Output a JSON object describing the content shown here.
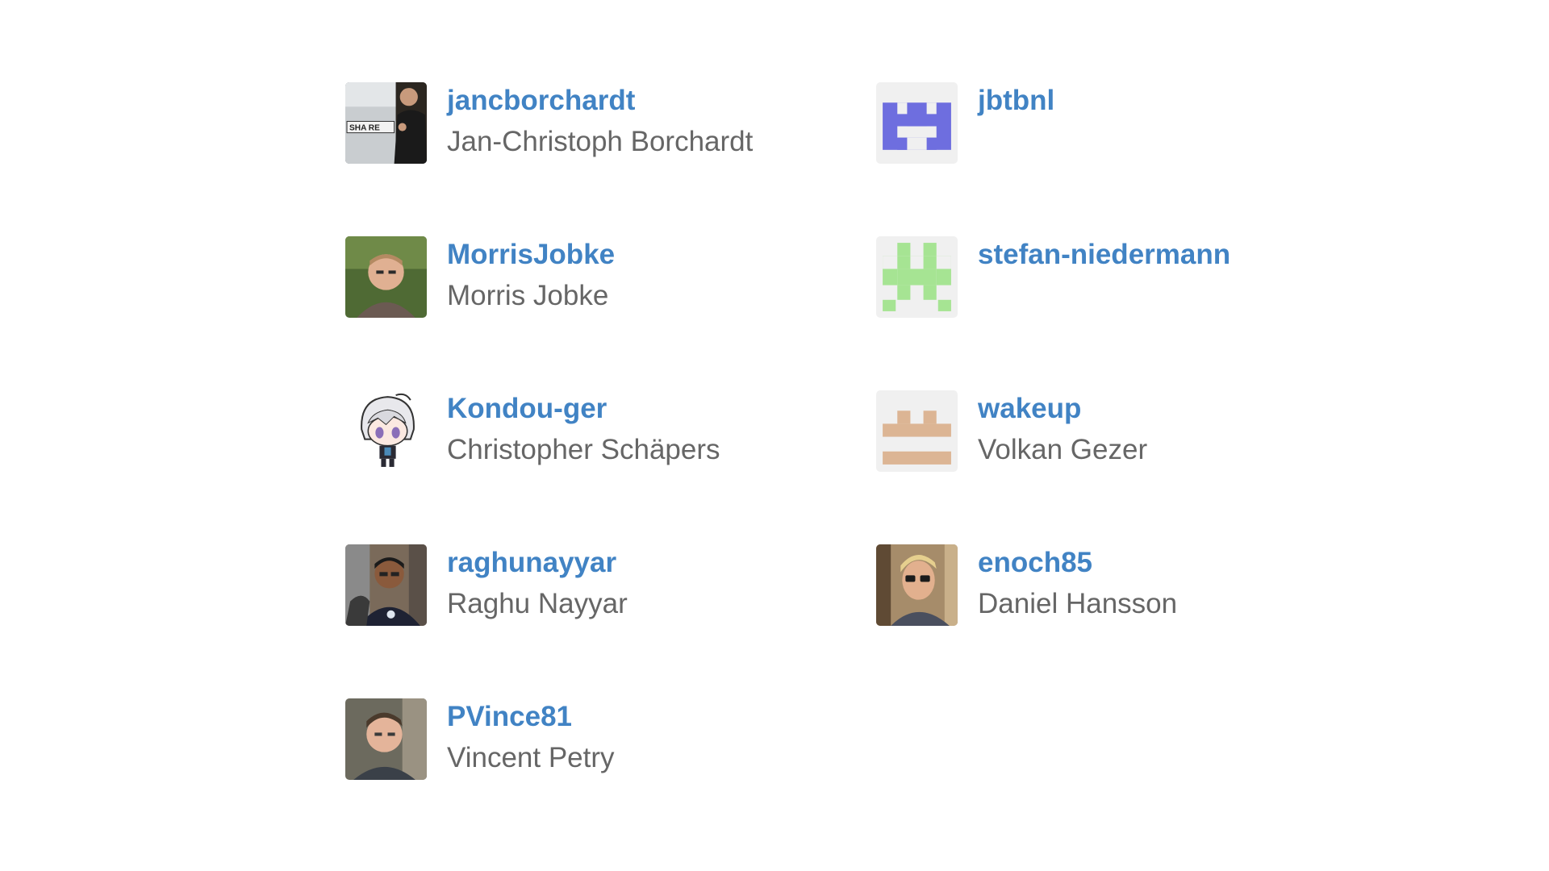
{
  "colors": {
    "link": "#4183c4",
    "name": "#666666",
    "identicon_bg": "#f0f0f0",
    "identicon_jbtbnl": "#6e6edf",
    "identicon_stefan": "#a6e493",
    "identicon_wakeup": "#dcb594"
  },
  "members": [
    {
      "login": "jancborchardt",
      "name": "Jan-Christoph Borchardt",
      "avatar": "photo-license-plate-icon"
    },
    {
      "login": "jbtbnl",
      "name": "",
      "avatar": "identicon-purple-icon"
    },
    {
      "login": "MorrisJobke",
      "name": "Morris Jobke",
      "avatar": "photo-portrait-icon"
    },
    {
      "login": "stefan-niedermann",
      "name": "",
      "avatar": "identicon-green-icon"
    },
    {
      "login": "Kondou-ger",
      "name": "Christopher Schäpers",
      "avatar": "anime-character-icon"
    },
    {
      "login": "wakeup",
      "name": "Volkan Gezer",
      "avatar": "identicon-tan-icon"
    },
    {
      "login": "raghunayyar",
      "name": "Raghu Nayyar",
      "avatar": "photo-portrait-icon"
    },
    {
      "login": "enoch85",
      "name": "Daniel Hansson",
      "avatar": "photo-sunglasses-icon"
    },
    {
      "login": "PVince81",
      "name": "Vincent Petry",
      "avatar": "photo-portrait-icon"
    }
  ]
}
